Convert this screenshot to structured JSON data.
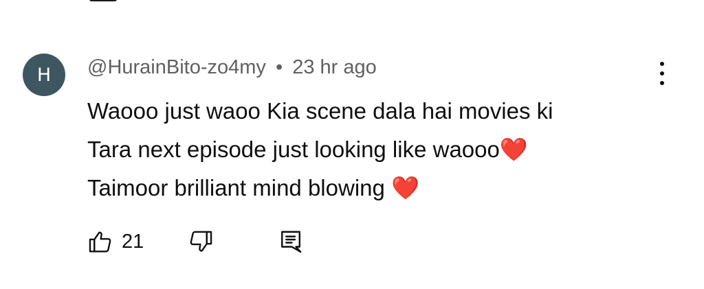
{
  "comment": {
    "avatar_letter": "H",
    "author": "@HurainBito-zo4my",
    "separator": "•",
    "time": "23 hr ago",
    "lines": [
      "Waooo just waoo  Kia scene dala hai movies ki",
      "Tara next episode just looking like waooo❤️",
      "Taimoor brilliant mind blowing ❤️"
    ],
    "like_count": "21",
    "icons": {
      "menu": "vertical-dots-icon",
      "like": "thumbs-up-icon",
      "dislike": "thumbs-down-icon",
      "reply": "comment-reply-icon"
    },
    "colors": {
      "avatar_bg": "#3e5660",
      "meta_text": "#606060",
      "text": "#0f0f0f"
    }
  }
}
